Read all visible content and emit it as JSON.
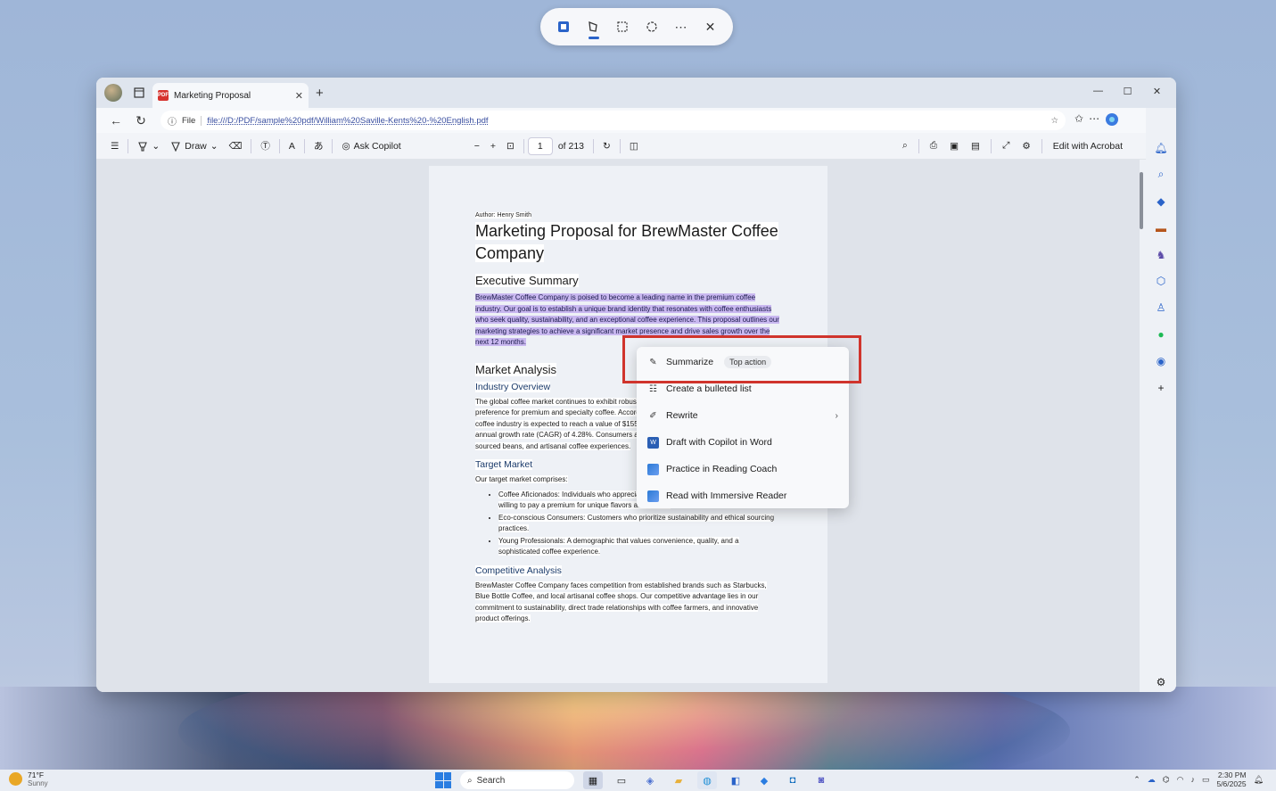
{
  "snip": {
    "close": "✕",
    "more": "⋯"
  },
  "tab": {
    "title": "Marketing Proposal"
  },
  "address": {
    "scheme": "File",
    "url": "file:///D:/PDF/sample%20pdf/William%20Saville-Kents%20-%20English.pdf"
  },
  "pdf_toolbar": {
    "draw": "Draw",
    "ask_copilot": "Ask Copilot",
    "page_current": "1",
    "page_total": "of 213",
    "edit_acrobat": "Edit with Acrobat"
  },
  "doc": {
    "author": "Author: Henry Smith",
    "title": "Marketing Proposal for BrewMaster Coffee Company",
    "exec_heading": "Executive Summary",
    "exec_text": "BrewMaster Coffee Company is poised to become a leading name in the premium coffee industry. Our goal is to establish a unique brand identity that resonates with coffee enthusiasts who seek quality, sustainability, and an exceptional coffee experience. This proposal outlines our marketing strategies to achieve a significant market presence and drive sales growth over the next 12 months.",
    "market_heading": "Market Analysis",
    "industry_heading": "Industry Overview",
    "industry_text": "The global coffee market continues to exhibit robust growth, driven by increasing consumer preference for premium and specialty coffee. According to recent market research, the global coffee industry is expected to reach a value of $155.64 billion by 2026, growing at a compound annual growth rate (CAGR) of 4.28%. Consumers are increasingly seeking high-quality, ethically sourced beans, and artisanal coffee experiences.",
    "target_heading": "Target Market",
    "target_intro": "Our target market comprises:",
    "target_items": [
      "Coffee Aficionados: Individuals who appreciate high-quality, specialty coffee and are willing to pay a premium for unique flavors and blends.",
      "Eco-conscious Consumers: Customers who prioritize sustainability and ethical sourcing practices.",
      "Young Professionals: A demographic that values convenience, quality, and a sophisticated coffee experience."
    ],
    "comp_heading": "Competitive Analysis",
    "comp_text": "BrewMaster Coffee Company faces competition from established brands such as Starbucks, Blue Bottle Coffee, and local artisanal coffee shops. Our competitive advantage lies in our commitment to sustainability, direct trade relationships with coffee farmers, and innovative product offerings."
  },
  "menu": {
    "summarize": "Summarize",
    "top_action": "Top action",
    "bulleted": "Create a bulleted list",
    "rewrite": "Rewrite",
    "draft_word": "Draft with Copilot in Word",
    "reading_coach": "Practice in Reading Coach",
    "immersive": "Read with Immersive Reader"
  },
  "taskbar": {
    "temp": "71°F",
    "condition": "Sunny",
    "search": "Search",
    "time": "2:30 PM",
    "date": "5/6/2025"
  }
}
